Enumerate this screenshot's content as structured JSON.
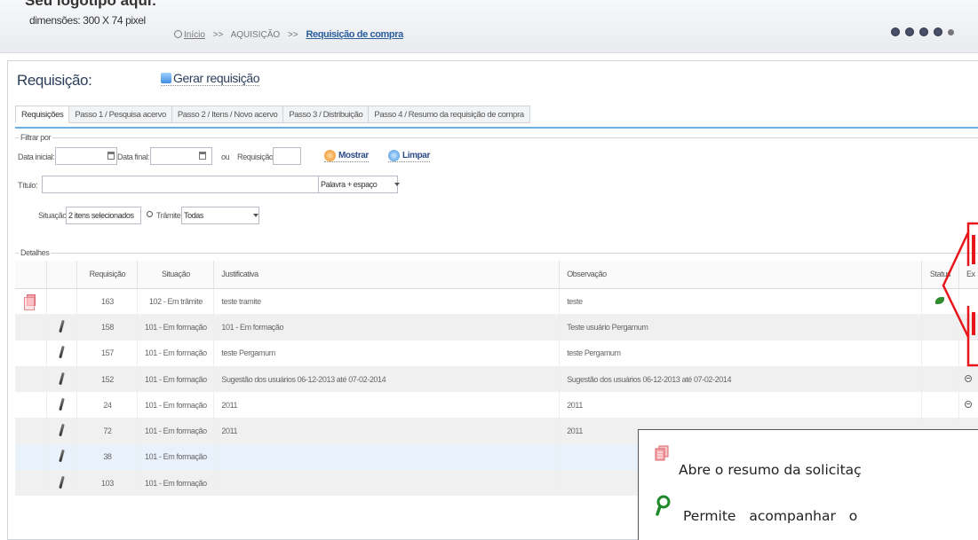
{
  "header": {
    "logo_title": "Seu logotipo aqui:",
    "logo_dimensions": "dimensões: 300 X 74 pixel",
    "breadcrumb": {
      "home": "Início",
      "separator": ">>",
      "section": "AQUISIÇÃO",
      "current": "Requisição de compra"
    },
    "icons": [
      "user-icon",
      "info-icon",
      "help-icon",
      "settings-icon",
      "power-icon"
    ]
  },
  "page": {
    "title": "Requisição:",
    "generate_label": "Gerar requisição",
    "tabs": [
      "Requisições",
      "Passo 1 / Pesquisa acervo",
      "Passo 2 / Itens / Novo acervo",
      "Passo 3 / Distribuição",
      "Passo 4 / Resumo da requisição de compra"
    ]
  },
  "filter": {
    "legend": "Filtrar por",
    "date_start_label": "Data inicial:",
    "date_start_value": "",
    "date_end_label": "Data final:",
    "date_end_value": "",
    "or_label": "ou",
    "request_label": "Requisição:",
    "request_value": "",
    "show_label": "Mostrar",
    "clear_label": "Limpar",
    "title_label": "Título:",
    "title_value": "",
    "title_mode": "Palavra + espaço",
    "situation_label": "Situação:",
    "situation_value": "2 itens selecionados",
    "process_label": "Trâmite:",
    "process_value": "Todas"
  },
  "details": {
    "legend": "Detalhes",
    "columns": [
      "Requisição",
      "Situação",
      "Justificativa",
      "Observação",
      "Status",
      "Ex"
    ],
    "rows": [
      {
        "id": "163",
        "situation": "102 - Em trâmite",
        "justification": "teste tramite",
        "observation": "teste",
        "action_icon": "document-stack-icon",
        "status_icon": "leaf-icon"
      },
      {
        "id": "158",
        "situation": "101 - Em formação",
        "justification": "101 - Em formação",
        "observation": "Teste usuário Pergamum",
        "action_icon": "pencil-icon",
        "status_icon": ""
      },
      {
        "id": "157",
        "situation": "101 - Em formação",
        "justification": "teste Pergamum",
        "observation": "teste Pergamum",
        "action_icon": "pencil-icon",
        "status_icon": ""
      },
      {
        "id": "152",
        "situation": "101 - Em formação",
        "justification": "Sugestão dos usuários 06-12-2013 até 07-02-2014",
        "observation": "Sugestão dos usuários 06-12-2013 até 07-02-2014",
        "action_icon": "pencil-icon",
        "status_icon": ""
      },
      {
        "id": "24",
        "situation": "101 - Em formação",
        "justification": "2011",
        "observation": "2011",
        "action_icon": "pencil-icon",
        "status_icon": ""
      },
      {
        "id": "72",
        "situation": "101 - Em formação",
        "justification": "2011",
        "observation": "2011",
        "action_icon": "pencil-icon",
        "status_icon": ""
      },
      {
        "id": "38",
        "situation": "101 - Em formação",
        "justification": "",
        "observation": "",
        "action_icon": "pencil-icon",
        "status_icon": ""
      },
      {
        "id": "103",
        "situation": "101 - Em formação",
        "justification": "",
        "observation": "",
        "action_icon": "pencil-icon",
        "status_icon": ""
      }
    ]
  },
  "annotation": {
    "line1": "Abre o resumo da solicitaç",
    "line2": "Permite acompanhar o",
    "callout_color": "#e8151b"
  }
}
